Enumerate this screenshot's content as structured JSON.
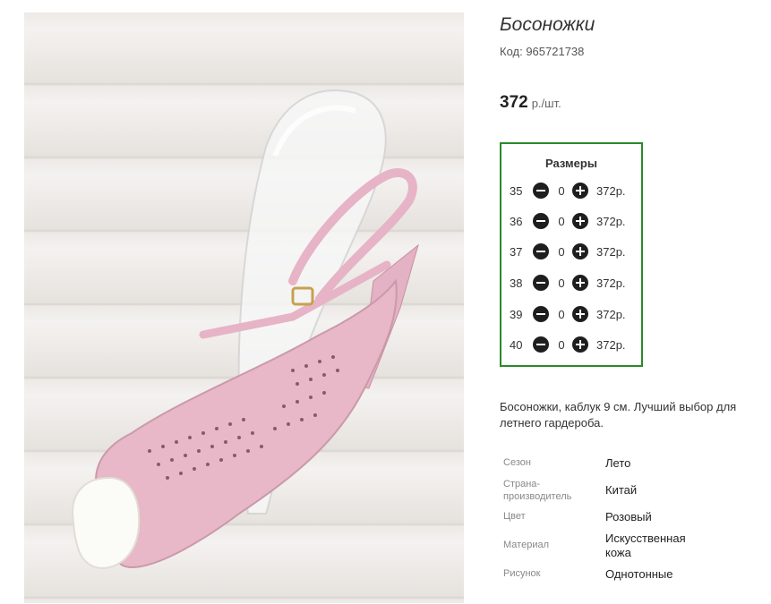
{
  "product": {
    "title": "Босоножки",
    "code": "Код: 965721738",
    "price": "372",
    "price_unit": "р./шт."
  },
  "sizes": {
    "title": "Размеры",
    "rows": [
      {
        "size": "35",
        "qty": "0",
        "price": "372р."
      },
      {
        "size": "36",
        "qty": "0",
        "price": "372р."
      },
      {
        "size": "37",
        "qty": "0",
        "price": "372р."
      },
      {
        "size": "38",
        "qty": "0",
        "price": "372р."
      },
      {
        "size": "39",
        "qty": "0",
        "price": "372р."
      },
      {
        "size": "40",
        "qty": "0",
        "price": "372р."
      }
    ]
  },
  "description": "Босоножки, каблук 9 см. Лучший выбор для летнего гардероба.",
  "properties": [
    {
      "key": "Сезон",
      "value": "Лето"
    },
    {
      "key": "Страна-производитель",
      "value": "Китай"
    },
    {
      "key": "Цвет",
      "value": "Розовый"
    },
    {
      "key": "Материал",
      "value": "Искусственная кожа"
    },
    {
      "key": "Рисунок",
      "value": "Однотонные"
    }
  ],
  "icons": {
    "decrease": "minus-circle-icon",
    "increase": "plus-circle-icon"
  },
  "colors": {
    "box_border": "#2a8a2a",
    "shoe": "#e8b8c8",
    "button": "#1e1e1e"
  }
}
